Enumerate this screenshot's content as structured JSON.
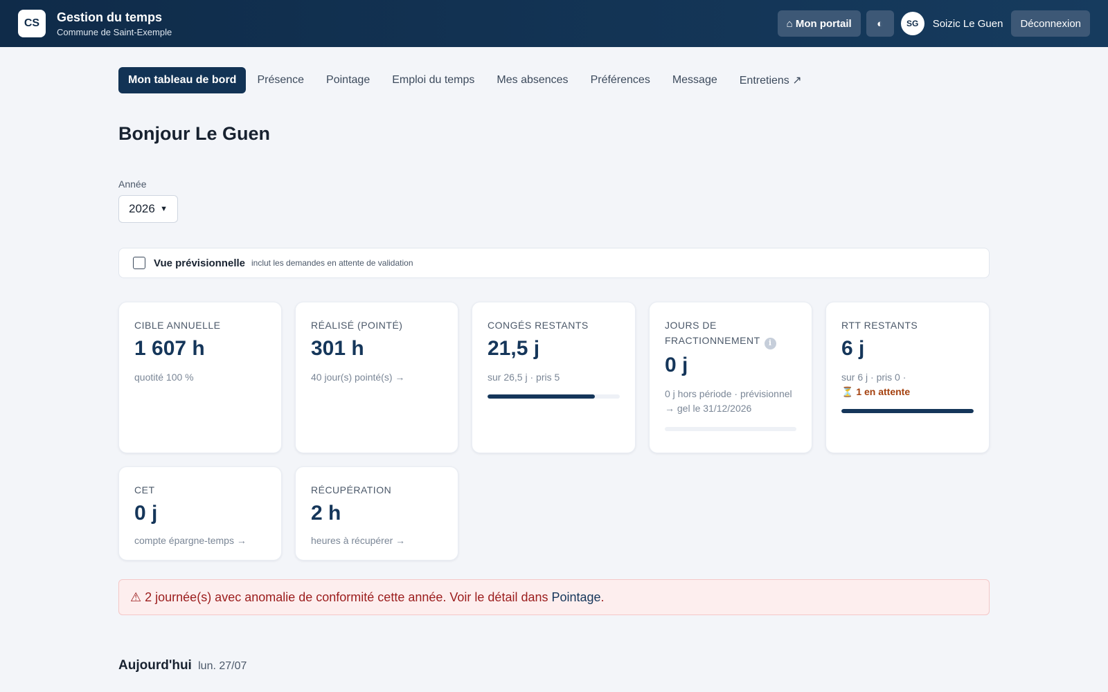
{
  "header": {
    "logo": "CS",
    "title": "Gestion du temps",
    "subtitle": "Commune de Saint-Exemple",
    "portal_label": "⌂ Mon portail",
    "theme_icon": "◐",
    "avatar_initials": "SG",
    "user_name": "Soizic Le Guen",
    "logout_label": "Déconnexion"
  },
  "nav": {
    "items": [
      {
        "label": "Mon tableau de bord"
      },
      {
        "label": "Présence"
      },
      {
        "label": "Pointage"
      },
      {
        "label": "Emploi du temps"
      },
      {
        "label": "Mes absences"
      },
      {
        "label": "Préférences"
      },
      {
        "label": "Message"
      },
      {
        "label": "Entretiens ↗"
      }
    ],
    "active_index": 0
  },
  "greeting": "Bonjour Le Guen",
  "year": {
    "label": "Année",
    "selected": "2026"
  },
  "forecast": {
    "label": "Vue prévisionnelle",
    "hint": "inclut les demandes en attente de validation",
    "checked": false
  },
  "cards": {
    "cible": {
      "label": "CIBLE ANNUELLE",
      "value": "1 607 h",
      "sub": "quotité 100 %"
    },
    "realise": {
      "label": "RÉALISÉ (POINTÉ)",
      "value": "301 h",
      "sub": "40 jour(s) pointé(s) →"
    },
    "conges": {
      "label": "CONGÉS RESTANTS",
      "value": "21,5 j",
      "sub": "sur 26,5 j · pris 5",
      "progress": 0.81
    },
    "fractionnement": {
      "label": "JOURS DE FRACTIONNEMENT",
      "value": "0 j",
      "sub": "0 j hors période · prévisionnel → gel le 31/12/2026",
      "progress": 0.0
    },
    "rtt": {
      "label": "RTT RESTANTS",
      "value": "6 j",
      "sub": "sur 6 j · pris 0 ·",
      "pending": "⏳ 1 en attente",
      "progress": 1.0
    },
    "cet": {
      "label": "CET",
      "value": "0 j",
      "sub": "compte épargne-temps →"
    },
    "recup": {
      "label": "RÉCUPÉRATION",
      "value": "2 h",
      "sub": "heures à récupérer →"
    }
  },
  "alert": {
    "text": "⚠ 2 journée(s) avec anomalie de conformité cette année. Voir le détail dans",
    "link": "Pointage",
    "end": "."
  },
  "today": {
    "title": "Aujourd'hui",
    "date": "lun. 27/07"
  },
  "colors": {
    "header_bg": "#0f2b49",
    "accent": "#15365a",
    "pending": "#a4400e",
    "alert_text": "#9b1c1c",
    "alert_bg": "#fdeeee"
  }
}
